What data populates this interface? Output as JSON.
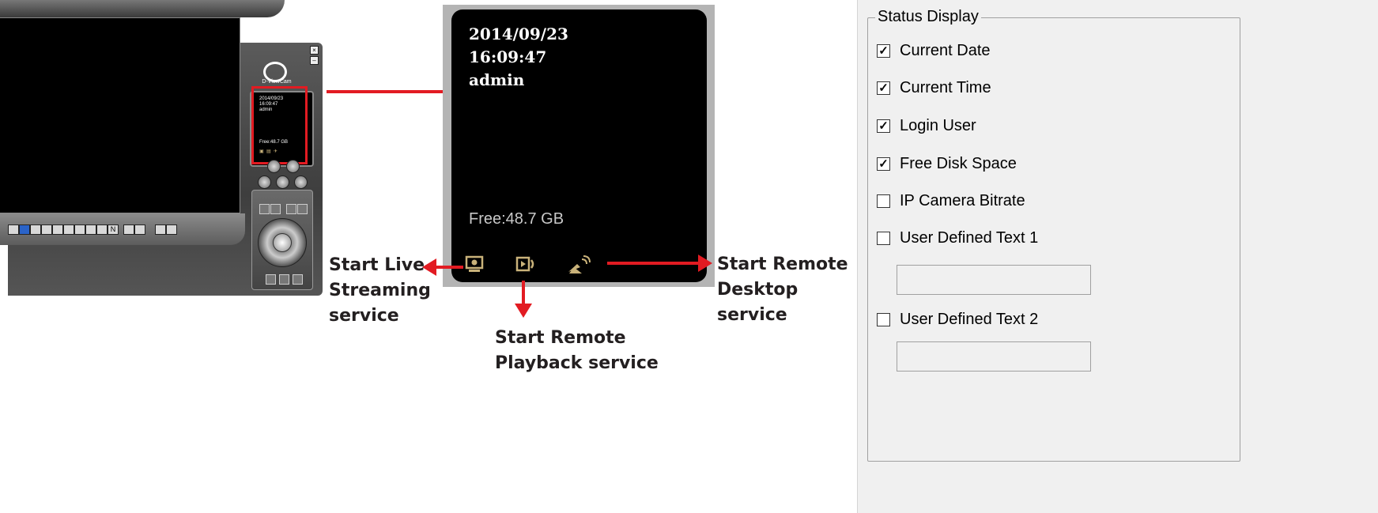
{
  "mini_window": {
    "logo_text": "D-ViewCam",
    "status": {
      "date": "2014/09/23",
      "time": "16:09:47",
      "user": "admin",
      "free": "Free:48.7 GB"
    },
    "close_glyph": "×",
    "min_glyph": "–",
    "channel_n": "N"
  },
  "status_panel": {
    "date": "2014/09/23",
    "time": "16:09:47",
    "user": "admin",
    "free": "Free:48.7 GB",
    "icons": [
      "live-streaming-icon",
      "remote-playback-icon",
      "remote-desktop-icon"
    ]
  },
  "callouts": {
    "live_streaming": [
      "Start Live",
      "Streaming",
      "service"
    ],
    "remote_playback": [
      "Start Remote",
      "Playback service"
    ],
    "remote_desktop": [
      "Start Remote",
      "Desktop",
      "service"
    ],
    "arrow_color": "#e21b22"
  },
  "status_display": {
    "title": "Status Display",
    "options": [
      {
        "label": "Current Date",
        "checked": true
      },
      {
        "label": "Current Time",
        "checked": true
      },
      {
        "label": "Login User",
        "checked": true
      },
      {
        "label": "Free Disk Space",
        "checked": true
      },
      {
        "label": "IP Camera Bitrate",
        "checked": false
      },
      {
        "label": "User Defined Text 1",
        "checked": false
      },
      {
        "label": "User Defined Text 2",
        "checked": false
      }
    ],
    "user_text_1": "",
    "user_text_2": ""
  }
}
